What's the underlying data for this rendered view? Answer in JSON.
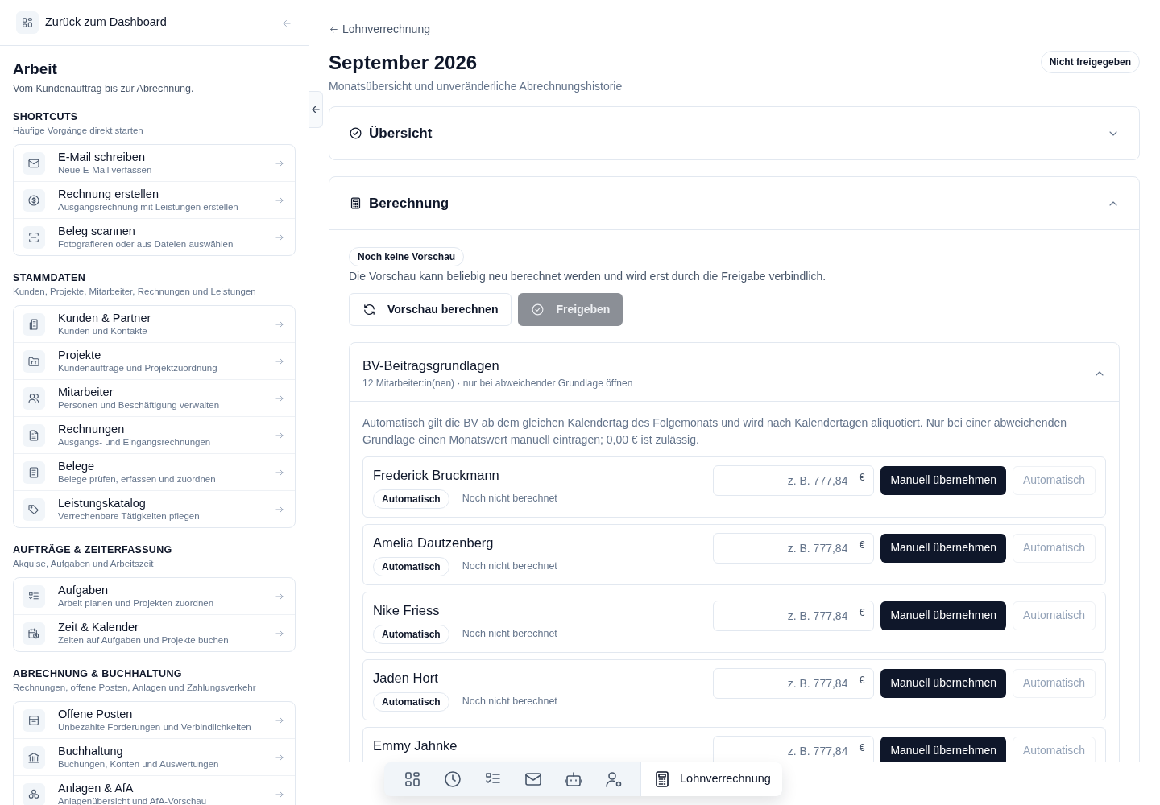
{
  "sidebar": {
    "back_link": "Zurück zum Dashboard",
    "title": "Arbeit",
    "subtitle": "Vom Kundenauftrag bis zur Abrechnung.",
    "groups": [
      {
        "heading": "SHORTCUTS",
        "description": "Häufige Vorgänge direkt starten",
        "items": [
          {
            "label": "E-Mail schreiben",
            "description": "Neue E-Mail verfassen"
          },
          {
            "label": "Rechnung erstellen",
            "description": "Ausgangsrechnung mit Leistungen erstellen"
          },
          {
            "label": "Beleg scannen",
            "description": "Fotografieren oder aus Dateien auswählen"
          }
        ]
      },
      {
        "heading": "STAMMDATEN",
        "description": "Kunden, Projekte, Mitarbeiter, Rechnungen und Leistungen",
        "items": [
          {
            "label": "Kunden & Partner",
            "description": "Kunden und Kontakte"
          },
          {
            "label": "Projekte",
            "description": "Kundenaufträge und Projektzuordnung"
          },
          {
            "label": "Mitarbeiter",
            "description": "Personen und Beschäftigung verwalten"
          },
          {
            "label": "Rechnungen",
            "description": "Ausgangs- und Eingangsrechnungen"
          },
          {
            "label": "Belege",
            "description": "Belege prüfen, erfassen und zuordnen"
          },
          {
            "label": "Leistungskatalog",
            "description": "Verrechenbare Tätigkeiten pflegen"
          }
        ]
      },
      {
        "heading": "AUFTRÄGE & ZEITERFASSUNG",
        "description": "Akquise, Aufgaben und Arbeitszeit",
        "items": [
          {
            "label": "Aufgaben",
            "description": "Arbeit planen und Projekten zuordnen"
          },
          {
            "label": "Zeit & Kalender",
            "description": "Zeiten auf Aufgaben und Projekte buchen"
          }
        ]
      },
      {
        "heading": "ABRECHNUNG & BUCHHALTUNG",
        "description": "Rechnungen, offene Posten, Anlagen und Zahlungsverkehr",
        "items": [
          {
            "label": "Offene Posten",
            "description": "Unbezahlte Forderungen und Verbindlichkeiten"
          },
          {
            "label": "Buchhaltung",
            "description": "Buchungen, Konten und Auswertungen"
          },
          {
            "label": "Anlagen & AfA",
            "description": "Anlagenübersicht und AfA-Vorschau"
          }
        ]
      }
    ]
  },
  "page": {
    "breadcrumb": "Lohnverrechnung",
    "title": "September 2026",
    "subtitle": "Monatsübersicht und unveränderliche Abrechnungshistorie",
    "status_badge": "Nicht freigegeben"
  },
  "sections": [
    {
      "title": "Übersicht",
      "expanded": false
    },
    {
      "title": "Berechnung",
      "expanded": true
    }
  ],
  "calculation": {
    "preview_badge": "Noch keine Vorschau",
    "note": "Die Vorschau kann beliebig neu berechnet werden und wird erst durch die Freigabe verbindlich.",
    "buttons": [
      {
        "label": "Vorschau berechnen",
        "kind": "outline",
        "disabled": false
      },
      {
        "label": "Freigeben",
        "kind": "primary",
        "disabled": true
      }
    ]
  },
  "bv": {
    "title": "BV-Beitragsgrundlagen",
    "subtitle": "12 Mitarbeiter:in(nen) · nur bei abweichender Grundlage öffnen",
    "expanded": true,
    "info": "Automatisch gilt die BV ab dem gleichen Kalendertag des Folgemonats und wird nach Kalendertagen aliquotiert. Nur bei einer abweichenden Grundlage einen Monatswert manuell eintragen; 0,00 € ist zulässig.",
    "employees": [
      {
        "name": "Frederick Bruckmann",
        "mode_badge": "Automatisch",
        "status": "Noch nicht berechnet",
        "placeholder": "z. B. 777,84",
        "currency": "€",
        "manual_button": "Manuell übernehmen",
        "auto_button": "Automatisch",
        "auto_disabled": true
      },
      {
        "name": "Amelia Dautzenberg",
        "mode_badge": "Automatisch",
        "status": "Noch nicht berechnet",
        "placeholder": "z. B. 777,84",
        "currency": "€",
        "manual_button": "Manuell übernehmen",
        "auto_button": "Automatisch",
        "auto_disabled": true
      },
      {
        "name": "Nike Friess",
        "mode_badge": "Automatisch",
        "status": "Noch nicht berechnet",
        "placeholder": "z. B. 777,84",
        "currency": "€",
        "manual_button": "Manuell übernehmen",
        "auto_button": "Automatisch",
        "auto_disabled": true
      },
      {
        "name": "Jaden Hort",
        "mode_badge": "Automatisch",
        "status": "Noch nicht berechnet",
        "placeholder": "z. B. 777,84",
        "currency": "€",
        "manual_button": "Manuell übernehmen",
        "auto_button": "Automatisch",
        "auto_disabled": true
      },
      {
        "name": "Emmy Jahnke",
        "placeholder": "z. B. 777,84",
        "currency": "€",
        "manual_button": "Manuell übernehmen",
        "auto_button": "Automatisch",
        "auto_disabled": true
      }
    ]
  },
  "dock": {
    "items": [
      {
        "selected": false
      },
      {
        "selected": false
      },
      {
        "selected": false
      },
      {
        "selected": false
      },
      {
        "selected": false
      },
      {
        "selected": false
      },
      {
        "label": "Lohnverrechnung",
        "selected": true
      }
    ]
  }
}
